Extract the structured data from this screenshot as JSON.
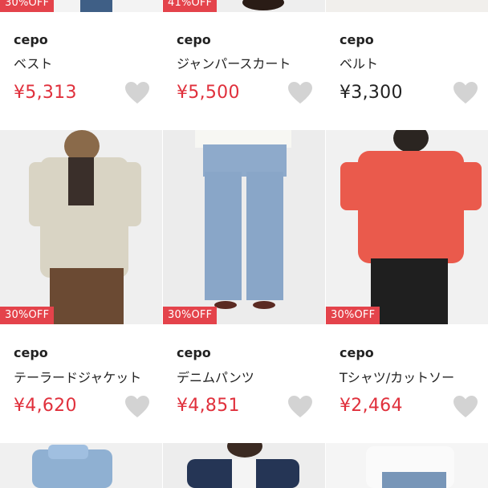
{
  "rows": [
    {
      "items": [
        {
          "badge": "30%OFF",
          "brand": "cepo",
          "name": "ベスト",
          "price": "¥5,313",
          "discounted": true,
          "bg": "#f3f3f3"
        },
        {
          "badge": "41%OFF",
          "brand": "cepo",
          "name": "ジャンパースカート",
          "price": "¥5,500",
          "discounted": true,
          "bg": "#eeeeee"
        },
        {
          "badge": "",
          "brand": "cepo",
          "name": "ベルト",
          "price": "¥3,300",
          "discounted": false,
          "bg": "#f1efec"
        }
      ]
    },
    {
      "items": [
        {
          "badge": "30%OFF",
          "brand": "cepo",
          "name": "テーラードジャケット",
          "price": "¥4,620",
          "discounted": true,
          "bg": "#f2f2f2"
        },
        {
          "badge": "30%OFF",
          "brand": "cepo",
          "name": "デニムパンツ",
          "price": "¥4,851",
          "discounted": true,
          "bg": "#ededed"
        },
        {
          "badge": "30%OFF",
          "brand": "cepo",
          "name": "Tシャツ/カットソー",
          "price": "¥2,464",
          "discounted": true,
          "bg": "#f2f2f2"
        }
      ]
    },
    {
      "items": [
        {
          "badge": "",
          "brand": "",
          "name": "",
          "price": "",
          "discounted": false,
          "bg": "#f2f2f2"
        },
        {
          "badge": "",
          "brand": "",
          "name": "",
          "price": "",
          "discounted": false,
          "bg": "#eeeeee"
        },
        {
          "badge": "",
          "brand": "",
          "name": "",
          "price": "",
          "discounted": false,
          "bg": "#f6f6f6"
        }
      ]
    }
  ],
  "colors": {
    "badge": "#e4434b",
    "sale_price": "#e0303c",
    "regular_price": "#222222",
    "heart": "#d3d3d3"
  },
  "icons": {
    "favorite": "heart-icon"
  }
}
